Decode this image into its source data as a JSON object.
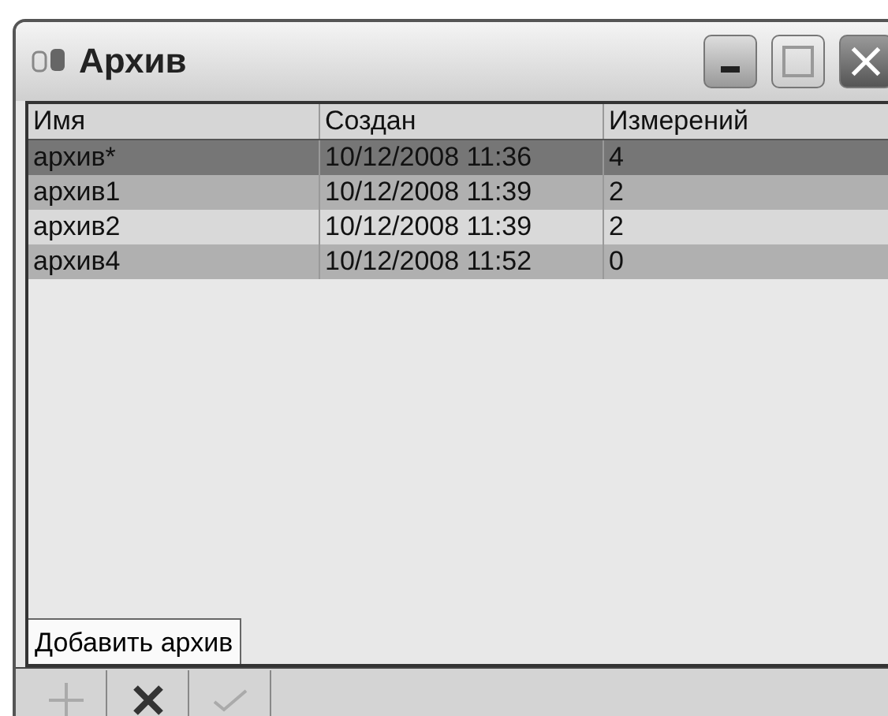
{
  "window": {
    "title": "Архив"
  },
  "table": {
    "columns": [
      "Имя",
      "Создан",
      "Измерений"
    ],
    "rows": [
      {
        "cells": [
          "архив*",
          "10/12/2008  11:36",
          "4"
        ],
        "selected": true
      },
      {
        "cells": [
          "архив1",
          "10/12/2008  11:39",
          "2"
        ],
        "selected": false
      },
      {
        "cells": [
          "архив2",
          "10/12/2008  11:39",
          "2"
        ],
        "selected": false
      },
      {
        "cells": [
          "архив4",
          "10/12/2008  11:52",
          "0"
        ],
        "selected": false
      }
    ]
  },
  "tooltip": "Добавить архив",
  "toolbar": [
    {
      "kind": "add",
      "disabled": true
    },
    {
      "kind": "delete",
      "disabled": false
    },
    {
      "kind": "apply",
      "disabled": true
    }
  ]
}
